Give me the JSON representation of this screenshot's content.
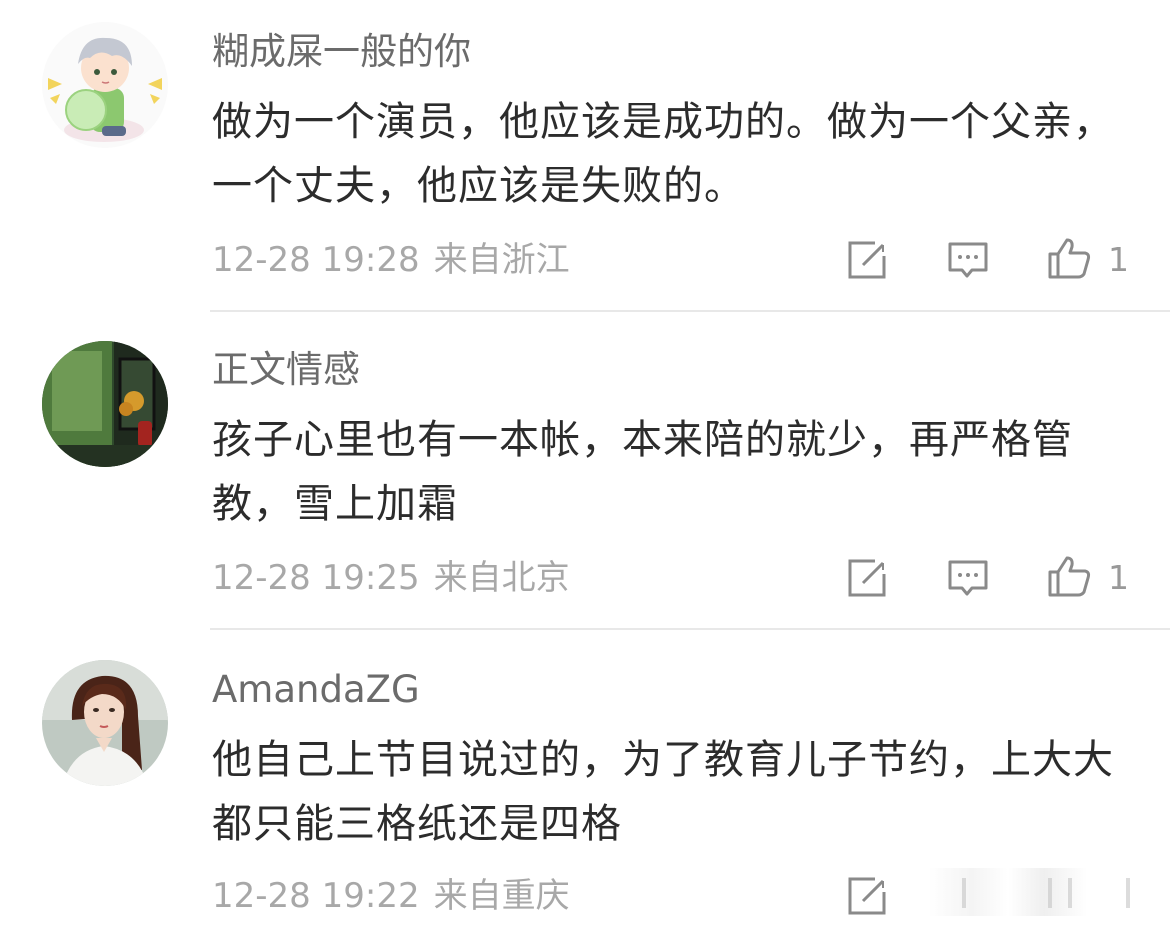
{
  "comments": [
    {
      "username": "糊成屎一般的你",
      "text": "做为一个演员，他应该是成功的。做为一个父亲，一个丈夫，他应该是失败的。",
      "time": "12-28 19:28",
      "location": "来自浙江",
      "likes": "1",
      "avatar": "cartoon-boy-avatar"
    },
    {
      "username": "正文情感",
      "text": "孩子心里也有一本帐，本来陪的就少，再严格管教，雪上加霜",
      "time": "12-28 19:25",
      "location": "来自北京",
      "likes": "1",
      "avatar": "window-plants-avatar"
    },
    {
      "username": "AmandaZG",
      "text": "他自己上节目说过的，为了教育儿子节约，上大大都只能三格纸还是四格",
      "time": "12-28 19:22",
      "location": "来自重庆",
      "likes": "",
      "avatar": "woman-portrait-avatar"
    }
  ],
  "icons": {
    "repost": "repost-icon",
    "comment": "comment-icon",
    "like": "thumbs-up-icon"
  },
  "colors": {
    "username": "#6b6b6b",
    "text": "#2c2c2c",
    "meta": "#a8a8a8",
    "divider": "#e8e8e8",
    "icon": "#8a8a8a"
  }
}
